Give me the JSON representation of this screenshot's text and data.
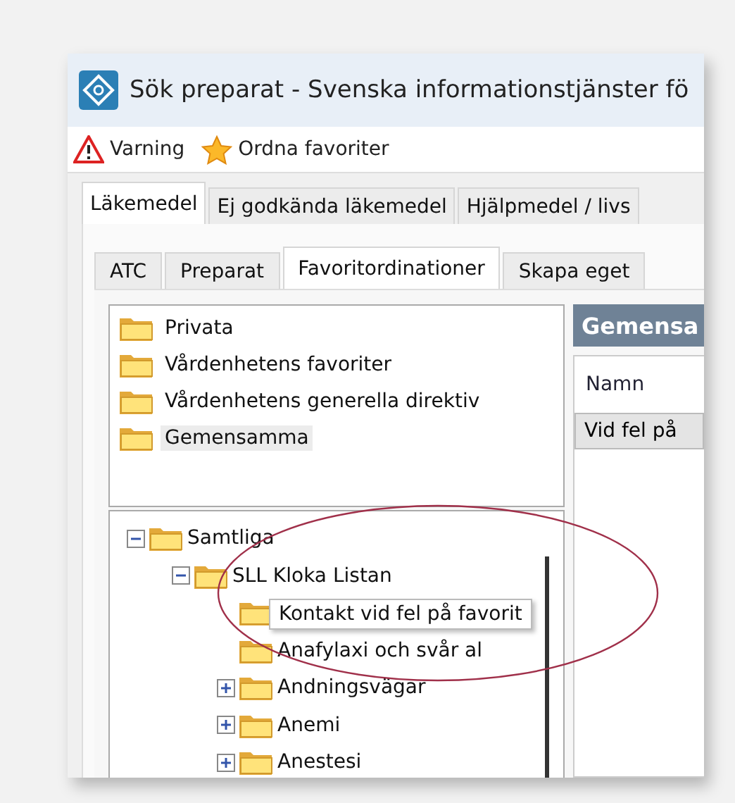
{
  "window": {
    "title": "Sök preparat - Svenska informationstjänster fö"
  },
  "toolbar": [
    {
      "label": "Varning",
      "kind": "warning"
    },
    {
      "label": "Ordna favoriter",
      "kind": "star"
    }
  ],
  "tabs": [
    {
      "label": "Läkemedel",
      "selected": true
    },
    {
      "label": "Ej godkända läkemedel",
      "selected": false
    },
    {
      "label": "Hjälpmedel / livs",
      "selected": false
    }
  ],
  "subtabs": [
    {
      "label": "ATC",
      "selected": false
    },
    {
      "label": "Preparat",
      "selected": false
    },
    {
      "label": "Favoritordinationer",
      "selected": true
    },
    {
      "label": "Skapa eget",
      "selected": false
    }
  ],
  "categories": [
    {
      "label": "Privata",
      "selected": false
    },
    {
      "label": "Vårdenhetens favoriter",
      "selected": false
    },
    {
      "label": "Vårdenhetens generella direktiv",
      "selected": false
    },
    {
      "label": "Gemensamma",
      "selected": true
    }
  ],
  "tree": [
    {
      "label": "Samtliga",
      "expanded": true,
      "children": [
        {
          "label": "SLL Kloka Listan",
          "expanded": true,
          "children": [
            {
              "tooltip": "Kontakt vid fel på favorit"
            },
            {
              "label": "Anafylaxi och svår al"
            },
            {
              "label": "Andningsvägar",
              "expanded": false
            },
            {
              "label": "Anemi",
              "expanded": false
            },
            {
              "label": "Anestesi",
              "expanded": false
            }
          ]
        }
      ]
    }
  ],
  "detail": {
    "header": "Gemensa",
    "columns": [
      "Namn"
    ],
    "rows": [
      {
        "cells": [
          "Vid fel på"
        ],
        "selected": true
      }
    ]
  },
  "annotation": {
    "kind": "ellipse",
    "color": "#a0304a"
  }
}
